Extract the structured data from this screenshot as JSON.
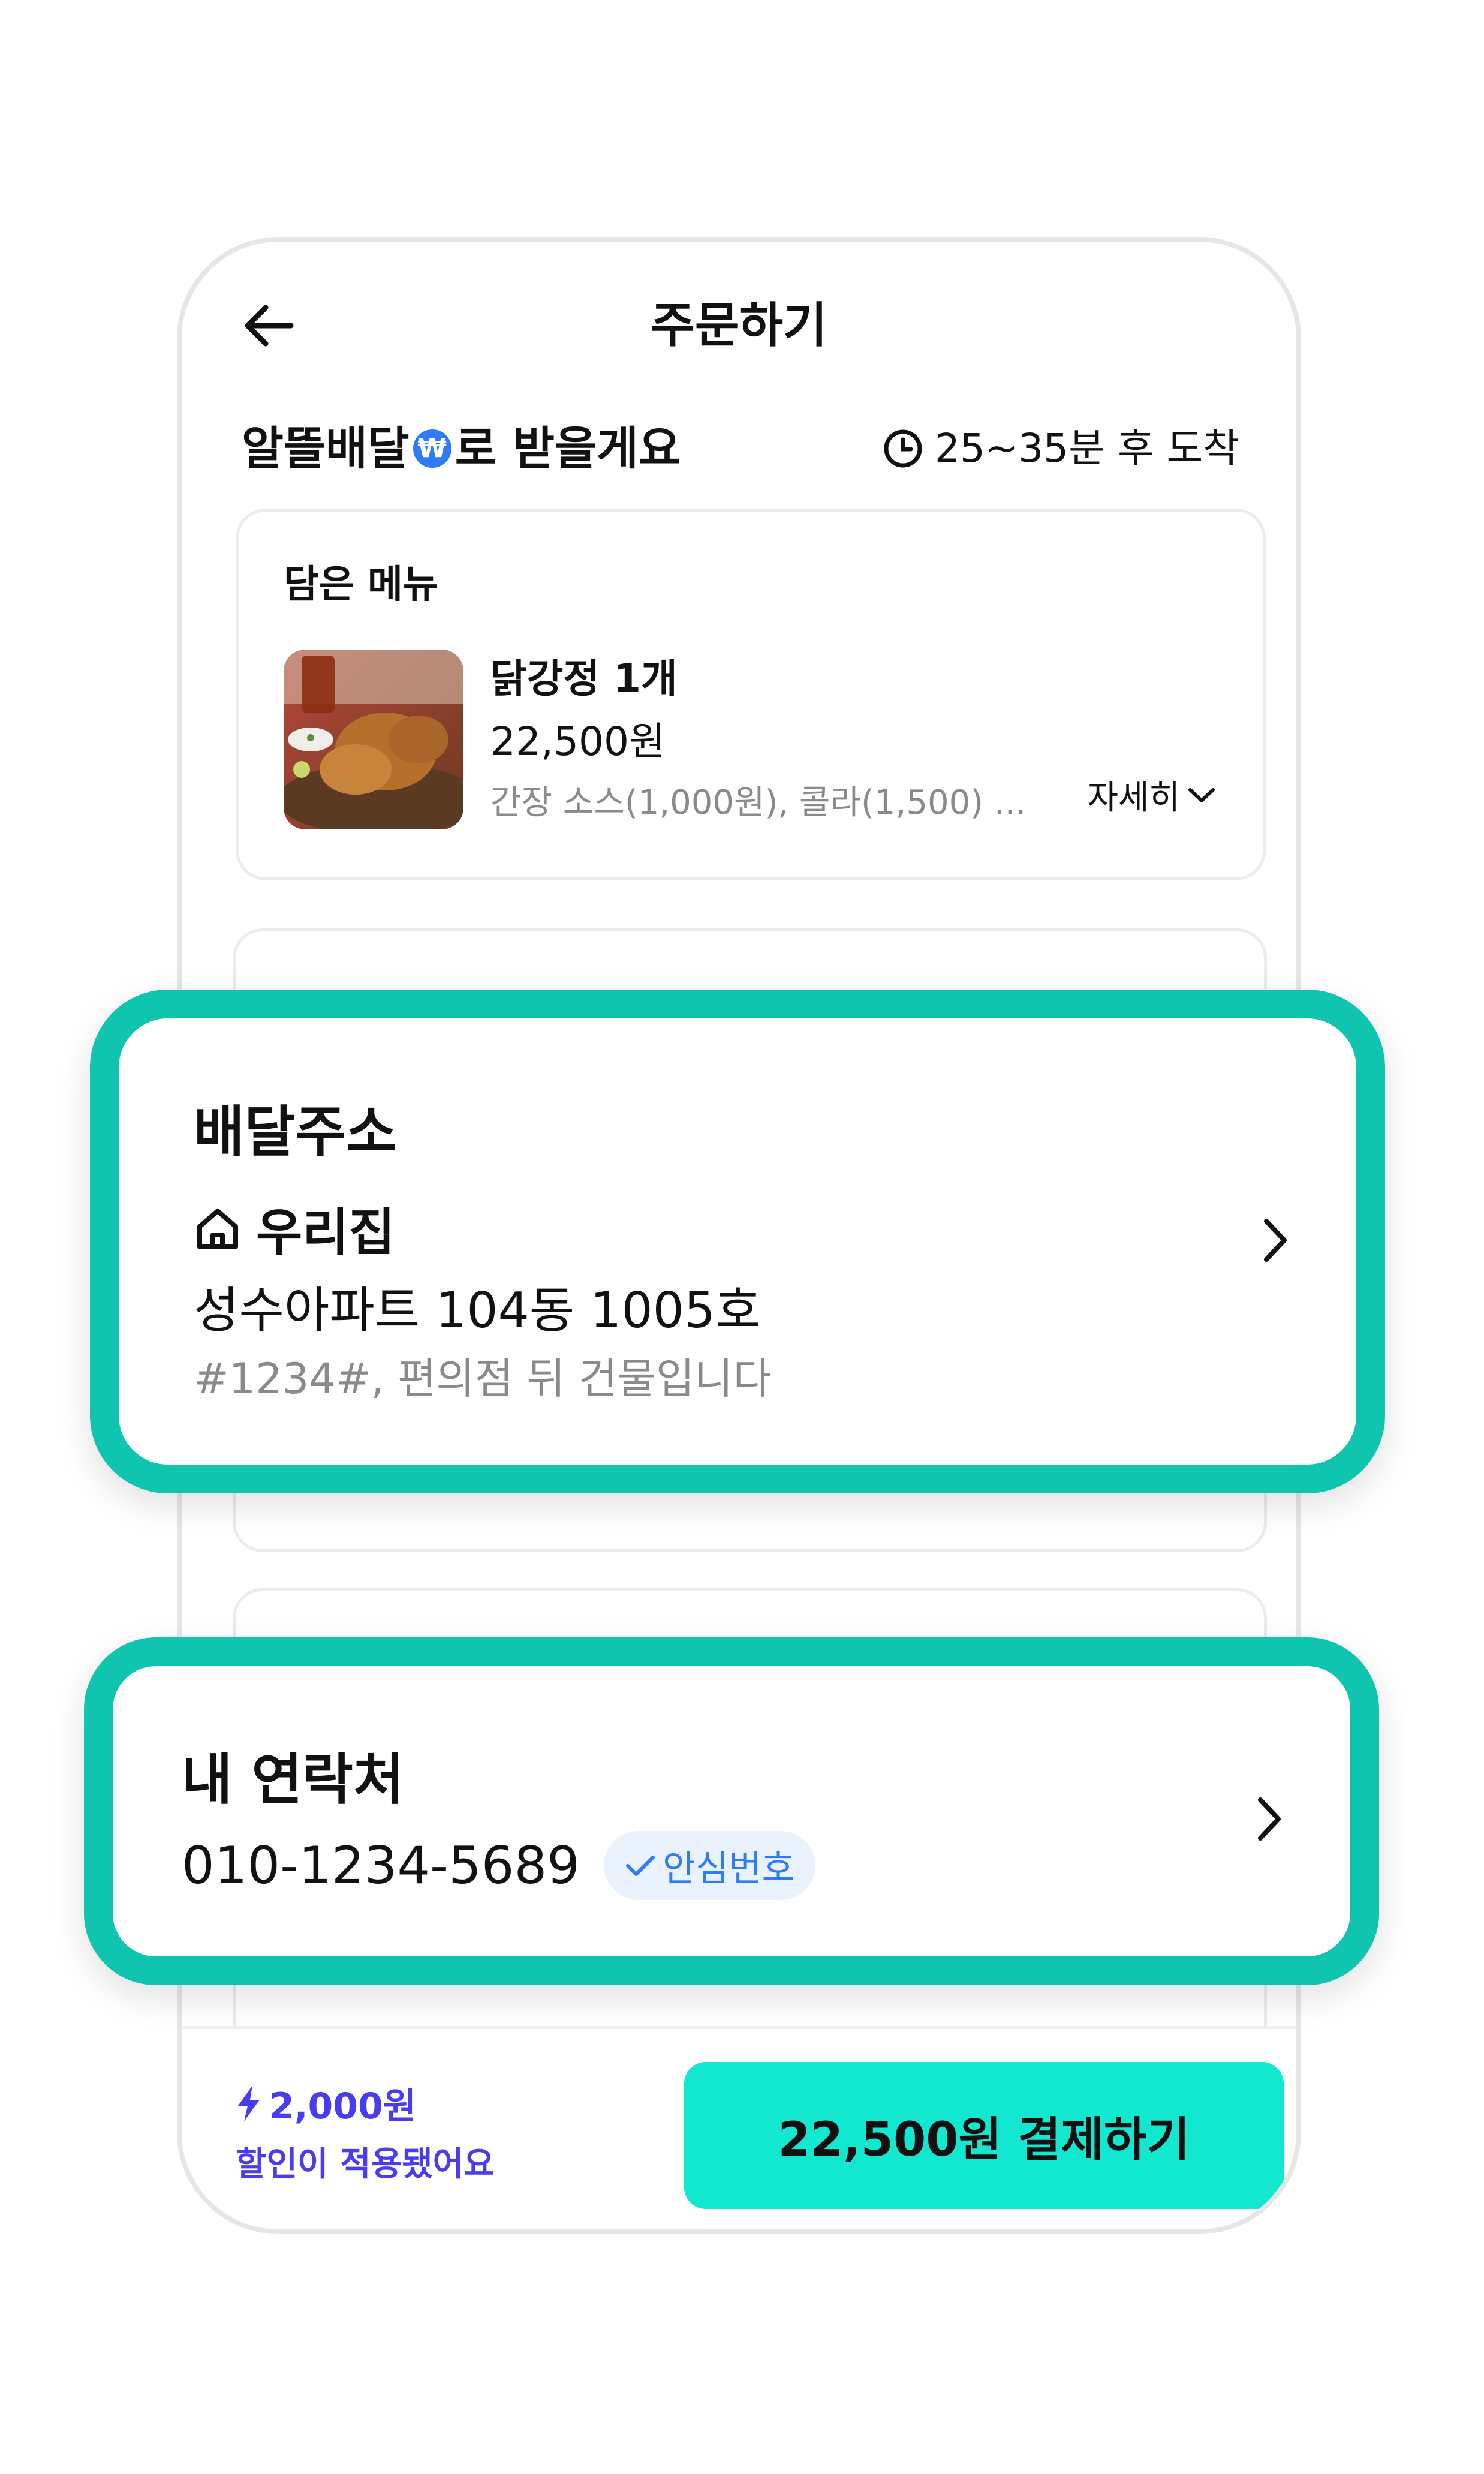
{
  "header": {
    "title": "주문하기"
  },
  "delivery": {
    "title_prefix": "알뜰배달",
    "badge_symbol": "₩",
    "title_suffix": "로 받을게요",
    "eta": "25~35분 후 도착"
  },
  "menu_card": {
    "title": "담은 메뉴",
    "item_name": "닭강정 1개",
    "item_price": "22,500원",
    "item_options": "간장 소스(1,000원), 콜라(1,500) ...",
    "details_label": "자세히"
  },
  "address": {
    "title": "배달주소",
    "name": "우리집",
    "line": "성수아파트 104동 1005호",
    "memo": "#1234#, 편의점 뒤 건물입니다"
  },
  "contact": {
    "title": "내 연락처",
    "phone": "010-1234-5689",
    "safe_number_label": "안심번호"
  },
  "bottom_bar": {
    "discount_amount": "2,000원",
    "discount_note": "할인이 적용됐어요",
    "pay_button_label": "22,500원 결제하기"
  },
  "colors": {
    "accent": "#10c5b0",
    "pay_button": "#11e8cf",
    "discount_text": "#4a3cf0",
    "badge_blue": "#2f7cf6"
  },
  "icons": [
    "back-arrow-icon",
    "won-badge-icon",
    "clock-icon",
    "chevron-down-icon",
    "home-icon",
    "chevron-right-icon",
    "check-icon",
    "lightning-icon"
  ]
}
